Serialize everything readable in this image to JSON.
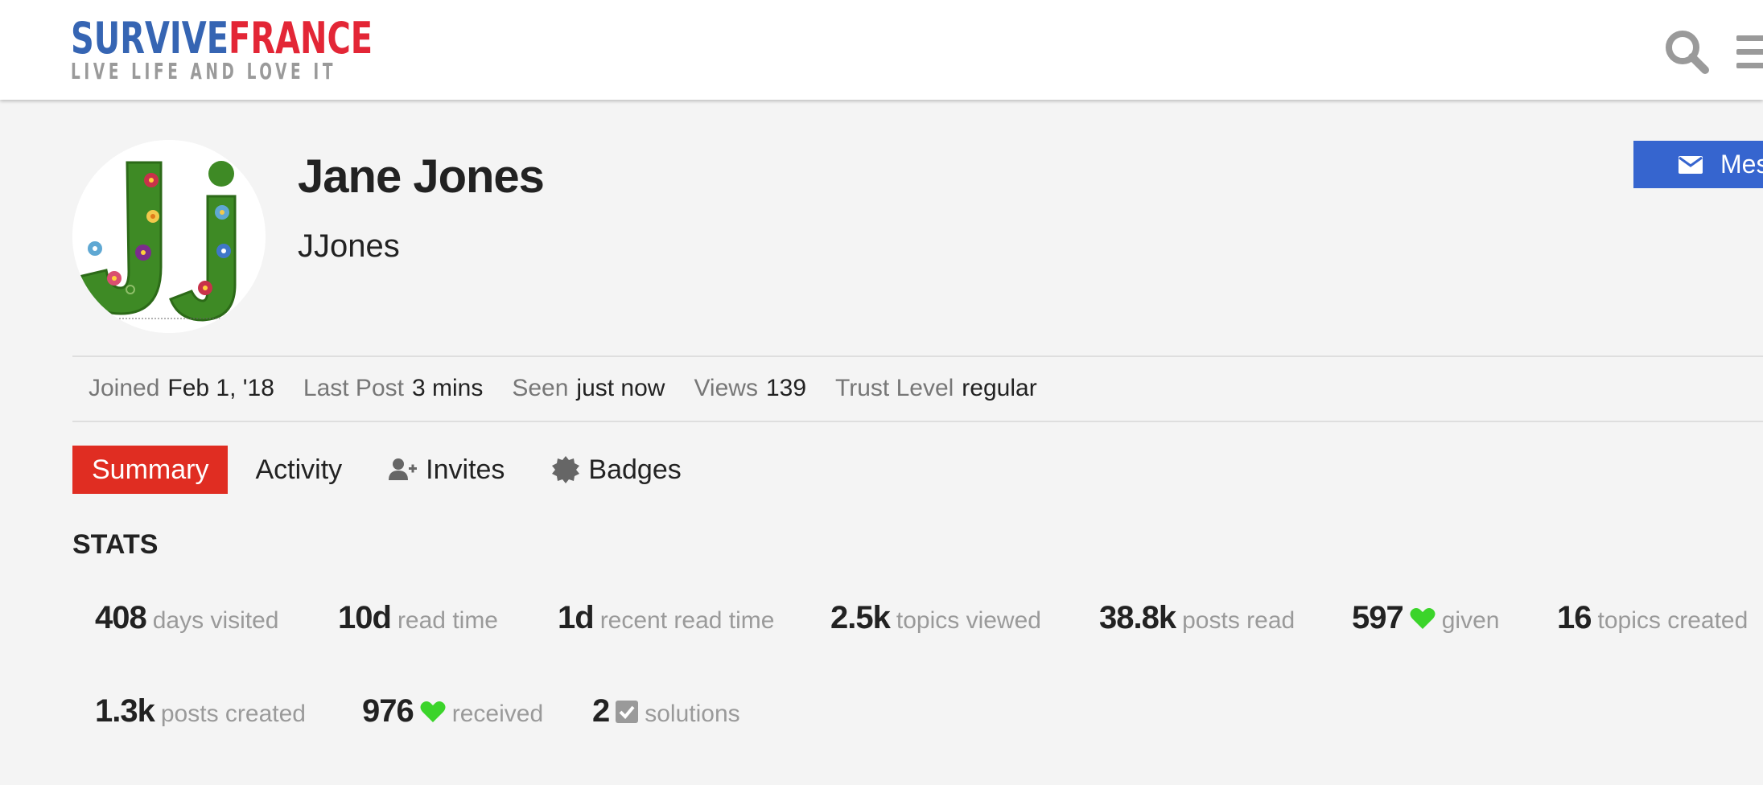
{
  "header": {
    "logo_part1": "SURVIVE",
    "logo_part2": "FRANCE",
    "logo_tagline": "LIVE LIFE AND LOVE IT",
    "icons": [
      "search-icon",
      "hamburger-menu-icon"
    ]
  },
  "profile": {
    "name": "Jane Jones",
    "username": "JJones",
    "message_button": "Mes",
    "avatar_icon": "avatar-grass-letters-jj"
  },
  "meta": [
    {
      "label": "Joined",
      "value": "Feb 1, '18"
    },
    {
      "label": "Last Post",
      "value": "3 mins"
    },
    {
      "label": "Seen",
      "value": "just now"
    },
    {
      "label": "Views",
      "value": "139"
    },
    {
      "label": "Trust Level",
      "value": "regular"
    }
  ],
  "tabs": [
    {
      "label": "Summary",
      "active": true
    },
    {
      "label": "Activity"
    },
    {
      "label": "Invites",
      "icon": "user-plus-icon"
    },
    {
      "label": "Badges",
      "icon": "badge-icon"
    }
  ],
  "stats": {
    "title": "STATS",
    "items": [
      {
        "value": "408",
        "label": "days visited"
      },
      {
        "value": "10d",
        "label": "read time"
      },
      {
        "value": "1d",
        "label": "recent read time"
      },
      {
        "value": "2.5k",
        "label": "topics viewed"
      },
      {
        "value": "38.8k",
        "label": "posts read"
      },
      {
        "value": "597",
        "label": "given",
        "icon": "heart-icon"
      },
      {
        "value": "16",
        "label": "topics created"
      },
      {
        "value": "1.3k",
        "label": "posts created"
      },
      {
        "value": "976",
        "label": "received",
        "icon": "heart-icon"
      },
      {
        "value": "2",
        "label": "solutions",
        "icon": "checkbox-icon"
      }
    ]
  },
  "colors": {
    "brand_blue": "#3665b3",
    "brand_red": "#e32636",
    "active_tab": "#e02d22",
    "message_button": "#3665cf",
    "heart": "#3bd42a"
  }
}
